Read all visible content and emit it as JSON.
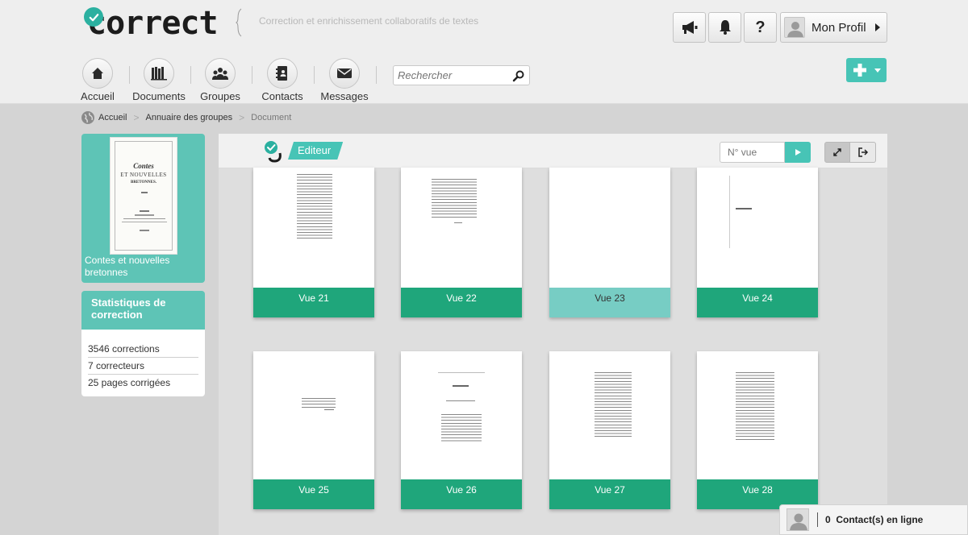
{
  "header": {
    "logo_text": "correct",
    "tagline": "Correction et enrichissement collaboratifs de textes",
    "profile_label": "Mon Profil",
    "help_label": "?"
  },
  "nav": {
    "items": [
      {
        "label": "Accueil",
        "icon": "home-icon"
      },
      {
        "label": "Documents",
        "icon": "books-icon"
      },
      {
        "label": "Groupes",
        "icon": "group-icon"
      },
      {
        "label": "Contacts",
        "icon": "address-book-icon"
      },
      {
        "label": "Messages",
        "icon": "envelope-icon"
      }
    ],
    "search_placeholder": "Rechercher"
  },
  "breadcrumb": [
    "Accueil",
    "Annuaire des groupes",
    "Document"
  ],
  "sidebar": {
    "book": {
      "caption": "Contes et nouvelles bretonnes",
      "cover_line1": "Contes",
      "cover_line2": "ET NOUVELLES",
      "cover_line3": "BRETONNES."
    },
    "stats": {
      "title": "Statistiques de correction",
      "rows": [
        "3546 corrections",
        "7 correcteurs",
        "25 pages corrigées"
      ]
    }
  },
  "editor": {
    "badge_label": "Editeur",
    "vue_placeholder": "N° vue",
    "pages": [
      {
        "label": "Vue 21",
        "active": false
      },
      {
        "label": "Vue 22",
        "active": false
      },
      {
        "label": "Vue 23",
        "active": true
      },
      {
        "label": "Vue 24",
        "active": false
      },
      {
        "label": "Vue 25",
        "active": false
      },
      {
        "label": "Vue 26",
        "active": false
      },
      {
        "label": "Vue 27",
        "active": false
      },
      {
        "label": "Vue 28",
        "active": false
      }
    ]
  },
  "footer": {
    "online_label": "0  Contact(s) en ligne"
  },
  "colors": {
    "accent": "#47c4b6",
    "page_label": "#1fa67b",
    "page_label_active": "#77cdc4"
  }
}
